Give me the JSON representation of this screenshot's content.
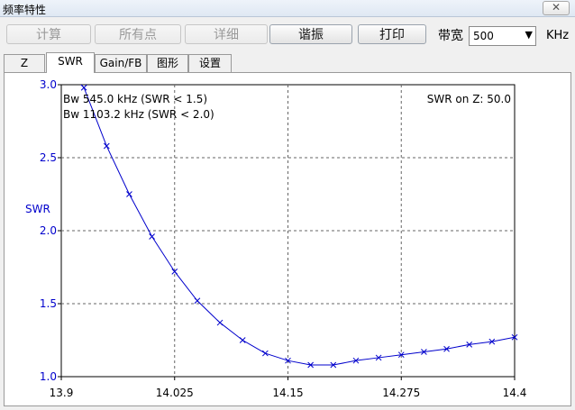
{
  "window": {
    "title": "频率特性",
    "close_label": "✕"
  },
  "toolbar": {
    "calc_label": "计算",
    "all_points_label": "所有点",
    "detail_label": "详细",
    "resonate_label": "谐振",
    "print_label": "打印",
    "bandwidth_label": "带宽",
    "bandwidth_value": "500",
    "bandwidth_unit": "KHz"
  },
  "tabs": [
    "Z",
    "SWR",
    "Gain/FB",
    "图形",
    "设置"
  ],
  "active_tab": "SWR",
  "chart_data": {
    "type": "line",
    "ylabel": "SWR",
    "xlabel": "",
    "xlim": [
      13.9,
      14.4
    ],
    "ylim": [
      1.0,
      3.0
    ],
    "x_ticks": [
      "13.9",
      "14.025",
      "14.15",
      "14.275",
      "14.4"
    ],
    "y_ticks": [
      "3.0",
      "2.5",
      "2.0",
      "1.5",
      "1.0"
    ],
    "grid": true,
    "annotations": [
      "Bw 545.0 kHz (SWR < 1.5)",
      "Bw 1103.2 kHz (SWR < 2.0)",
      "SWR on Z: 50.0"
    ],
    "series": [
      {
        "color": "#0000cc",
        "x": [
          13.9,
          13.925,
          13.95,
          13.975,
          14.0,
          14.025,
          14.05,
          14.075,
          14.1,
          14.125,
          14.15,
          14.175,
          14.2,
          14.225,
          14.25,
          14.275,
          14.3,
          14.325,
          14.35,
          14.375,
          14.4
        ],
        "y": [
          3.14,
          2.98,
          2.58,
          2.25,
          1.96,
          1.72,
          1.52,
          1.37,
          1.25,
          1.16,
          1.11,
          1.08,
          1.08,
          1.11,
          1.13,
          1.15,
          1.17,
          1.19,
          1.22,
          1.24,
          1.27
        ]
      }
    ]
  }
}
